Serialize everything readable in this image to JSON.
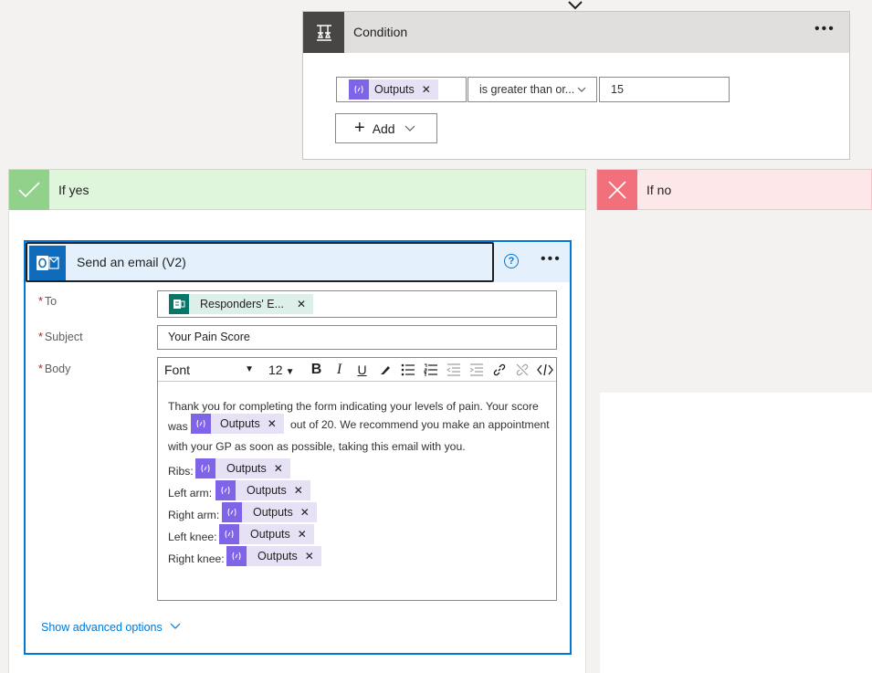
{
  "condition": {
    "title": "Condition",
    "operand_token": "Outputs",
    "operator": "is greater than or...",
    "value": "15",
    "add_label": "Add"
  },
  "branches": {
    "yes_label": "If yes",
    "no_label": "If no"
  },
  "email": {
    "title": "Send an email (V2)",
    "help": "?",
    "to_label": "To",
    "to_token": "Responders' E...",
    "subject_label": "Subject",
    "subject_value": "Your Pain Score",
    "body_label": "Body",
    "toolbar": {
      "font": "Font",
      "size": "12"
    },
    "body": {
      "p1_line1": "Thank you for completing the form indicating your levels of pain. Your score",
      "p1_was": "was",
      "p1_after": "out of 20. We recommend you make an appointment",
      "p1_line3": "with your GP as soon as possible, taking this email with you.",
      "score_token": "Outputs",
      "rows": [
        {
          "label": "Ribs:",
          "token": "Outputs"
        },
        {
          "label": "Left arm:",
          "token": "Outputs"
        },
        {
          "label": "Right arm:",
          "token": "Outputs"
        },
        {
          "label": "Left knee:",
          "token": "Outputs"
        },
        {
          "label": "Right knee:",
          "token": "Outputs"
        }
      ]
    },
    "advanced_label": "Show advanced options"
  },
  "colors": {
    "accent": "#0078d4",
    "expression_token": "#8064e8",
    "yes_green": "#92d18c",
    "no_red": "#f1707b"
  },
  "icons": {
    "condition": "condition-icon",
    "expression": "fx-icon",
    "outlook": "outlook-icon",
    "forms": "forms-icon"
  }
}
